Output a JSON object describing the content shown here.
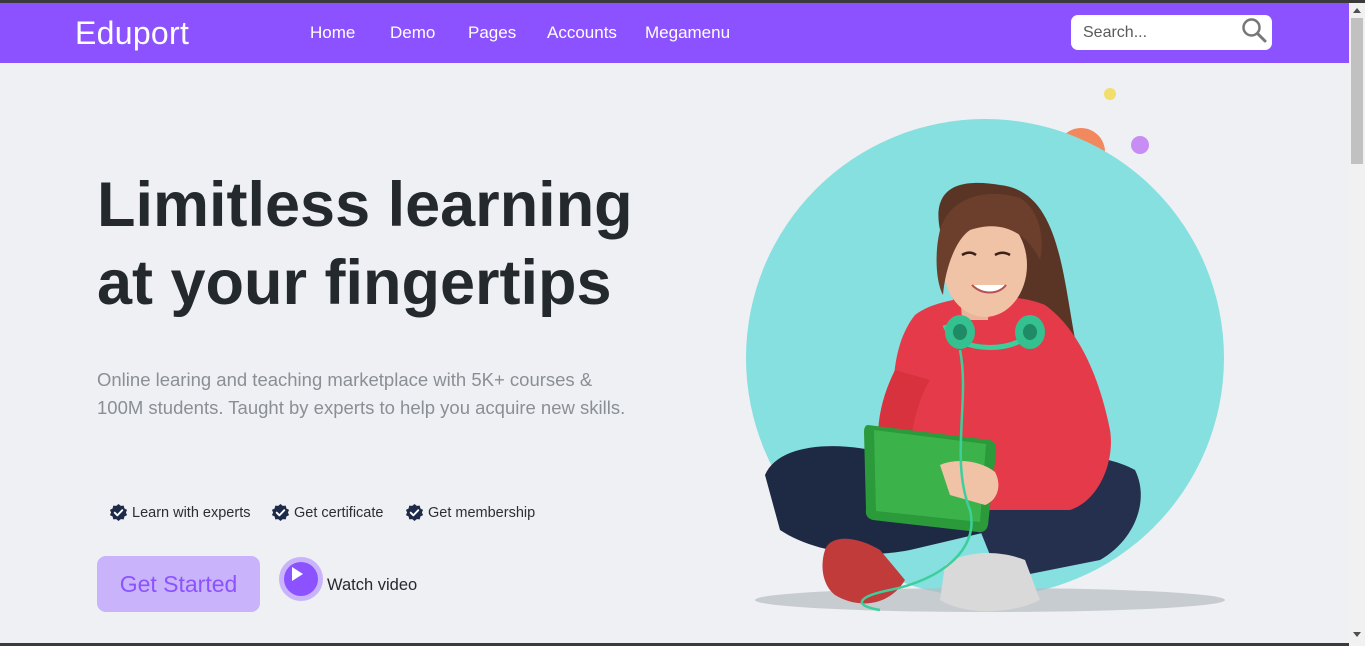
{
  "brand": {
    "name": "Eduport"
  },
  "nav": {
    "items": [
      {
        "label": "Home"
      },
      {
        "label": "Demo"
      },
      {
        "label": "Pages"
      },
      {
        "label": "Accounts"
      },
      {
        "label": "Megamenu"
      }
    ]
  },
  "search": {
    "placeholder": "Search...",
    "icon": "search-icon"
  },
  "hero": {
    "headline_line1": "Limitless learning",
    "headline_line2": "at your fingertips",
    "subtitle_line1": "Online learing and teaching marketplace with 5K+ courses &",
    "subtitle_line2": "100M students. Taught by experts to help you acquire new skills.",
    "features": [
      {
        "label": "Learn with experts",
        "icon": "check-badge-icon"
      },
      {
        "label": "Get certificate",
        "icon": "check-badge-icon"
      },
      {
        "label": "Get membership",
        "icon": "check-badge-icon"
      }
    ],
    "cta_label": "Get Started",
    "video_label": "Watch video",
    "image": "student-with-tablet-illustration"
  },
  "colors": {
    "accent": "#8c52ff",
    "accent_light": "#c9b3fb",
    "heading": "#24292d",
    "muted_text": "#8a8f96",
    "background": "#eef0f3",
    "hero_circle": "#86e0e0",
    "dot_orange": "#f2895e",
    "dot_yellow": "#f3dd6b",
    "dot_purple": "#c88cf5"
  }
}
